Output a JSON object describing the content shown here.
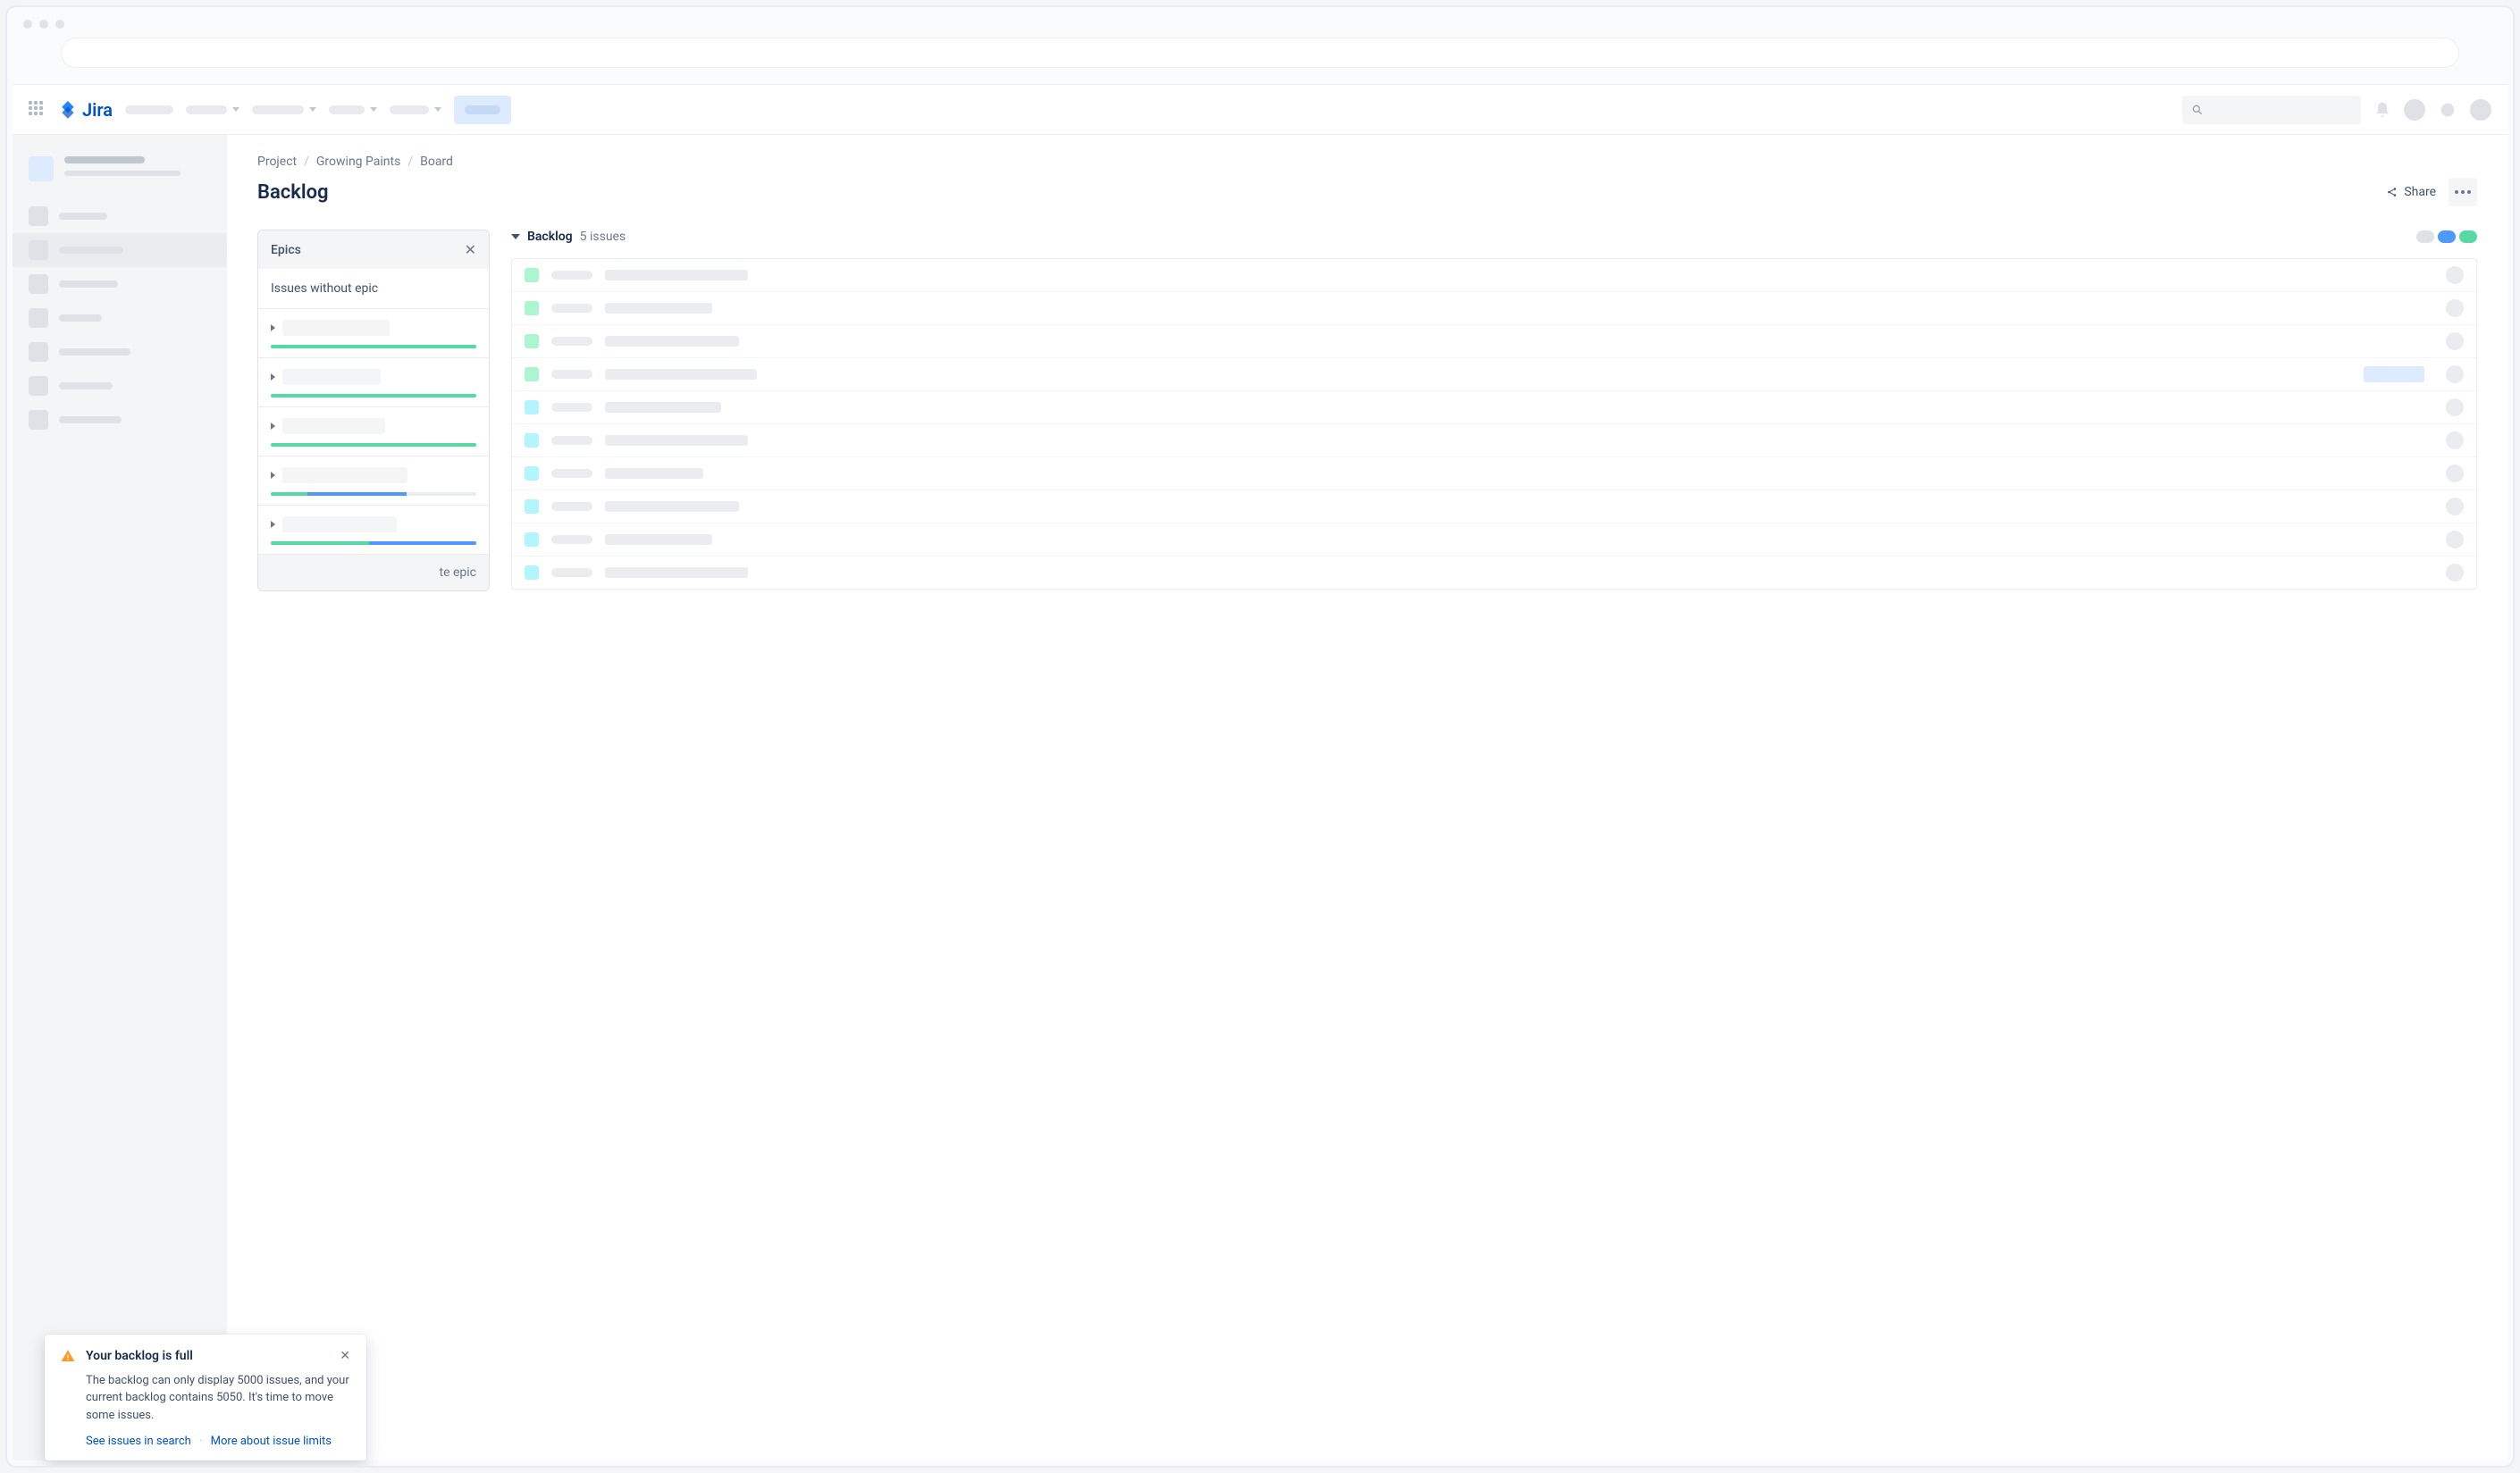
{
  "product_name": "Jira",
  "breadcrumb": {
    "project": "Project",
    "name": "Growing Paints",
    "board": "Board"
  },
  "page_title": "Backlog",
  "header": {
    "share_label": "Share"
  },
  "epics_panel": {
    "header": "Epics",
    "issues_without_epic": "Issues without epic",
    "create_epic_suffix": "te epic"
  },
  "backlog": {
    "title": "Backlog",
    "count_label": "5 issues"
  },
  "flag": {
    "title": "Your backlog is full",
    "body": "The backlog can only display 5000 issues, and your current backlog contains 5050. It's time to move some issues.",
    "action_see": "See issues in search",
    "action_more": "More about issue limits"
  }
}
